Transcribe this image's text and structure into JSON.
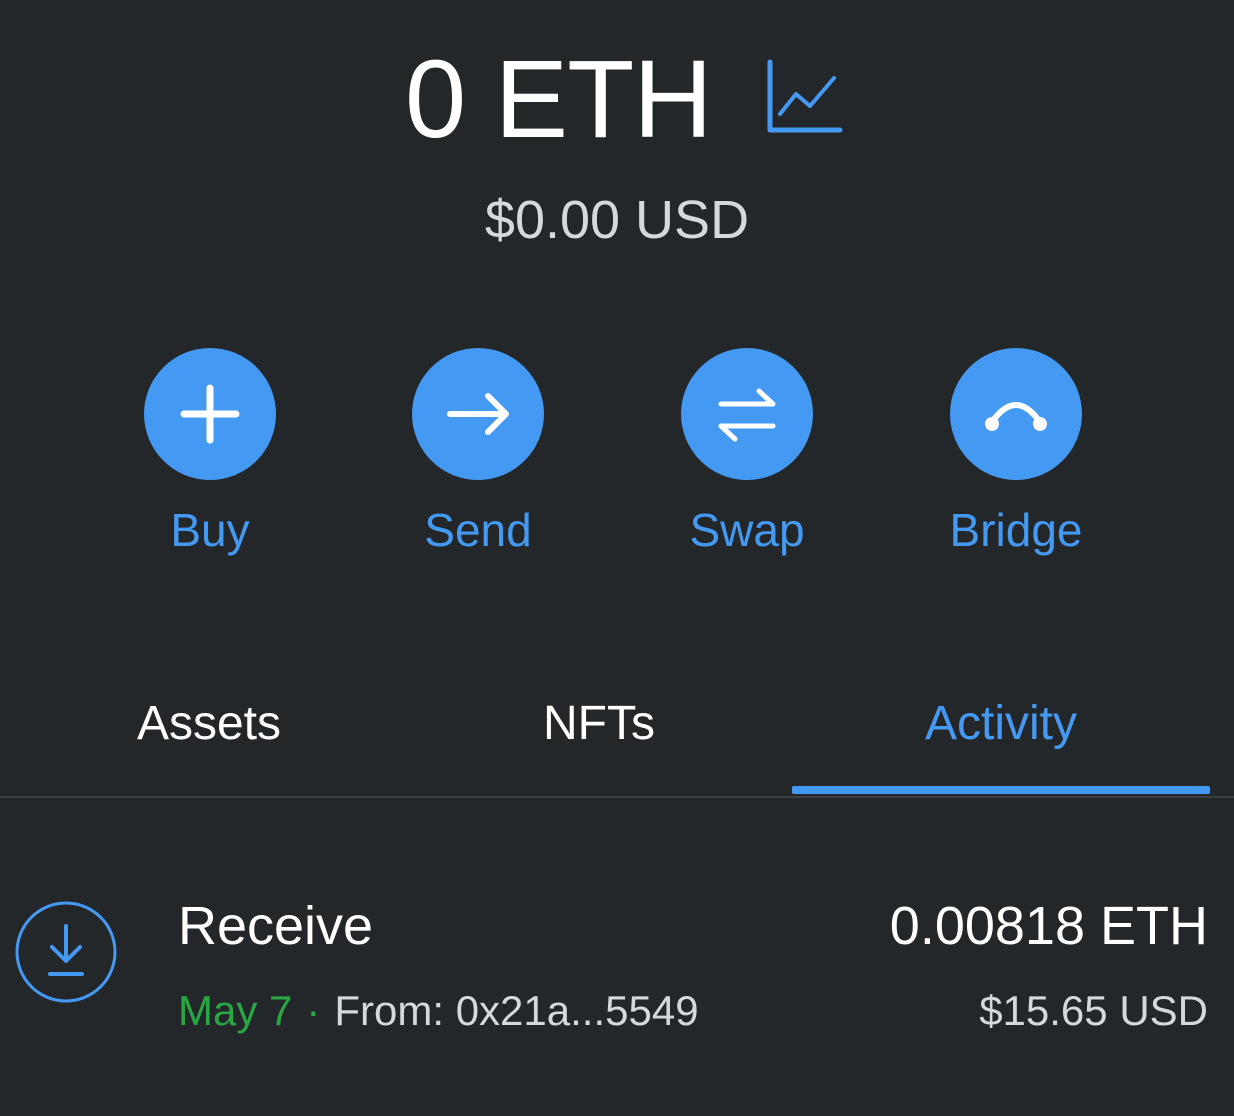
{
  "balance": {
    "amount": "0 ETH",
    "fiat": "$0.00 USD",
    "chart_icon": "line-chart-icon"
  },
  "actions": [
    {
      "label": "Buy",
      "icon": "plus-icon"
    },
    {
      "label": "Send",
      "icon": "arrow-right-icon"
    },
    {
      "label": "Swap",
      "icon": "swap-arrows-icon"
    },
    {
      "label": "Bridge",
      "icon": "bridge-icon"
    }
  ],
  "tabs": [
    {
      "label": "Assets",
      "active": false
    },
    {
      "label": "NFTs",
      "active": false
    },
    {
      "label": "Activity",
      "active": true
    }
  ],
  "activity": [
    {
      "icon": "receive-icon",
      "title": "Receive",
      "date": "May 7",
      "separator": "·",
      "from": "From: 0x21a...5549",
      "amount": "0.00818 ETH",
      "fiat": "$15.65 USD"
    }
  ],
  "colors": {
    "background": "#24272a",
    "accent": "#4499f2",
    "success": "#28a745",
    "text_primary": "#ffffff",
    "text_secondary": "#d6d9dc",
    "divider": "#3b3f44"
  }
}
